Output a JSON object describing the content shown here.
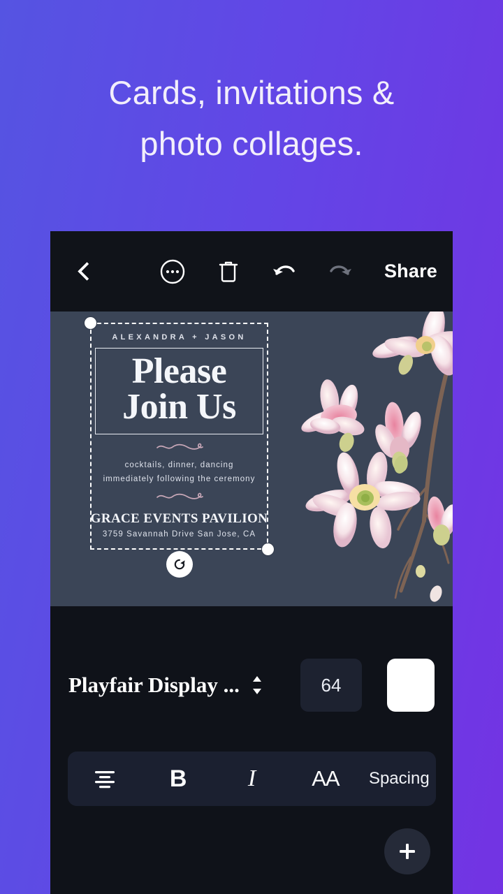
{
  "promo": {
    "headline_line1": "Cards, invitations &",
    "headline_line2": "photo collages."
  },
  "appbar": {
    "back_icon": "chevron-left-icon",
    "more_icon": "more-options-circle-icon",
    "delete_icon": "trash-icon",
    "undo_icon": "undo-arrow-icon",
    "redo_icon": "redo-arrow-icon",
    "share_label": "Share"
  },
  "canvas": {
    "background_color": "#3b4557",
    "artwork": "magnolia-flowers-watercolor",
    "rotate_icon": "rotate-handle-icon",
    "invitation": {
      "names": "ALEXANDRA + JASON",
      "title_line1": "Please",
      "title_line2": "Join Us",
      "detail_line1": "cocktails, dinner, dancing",
      "detail_line2": "immediately following the ceremony",
      "venue": "GRACE EVENTS PAVILION",
      "address": "3759 Savannah Drive San Jose, CA"
    }
  },
  "controls": {
    "font_name": "Playfair Display ...",
    "stepper_icon": "chevron-updown-icon",
    "font_size": "64",
    "color_swatch": "#ffffff"
  },
  "format_bar": {
    "align_icon": "align-center-icon",
    "bold_label": "B",
    "italic_label": "I",
    "case_label": "AA",
    "spacing_label": "Spacing"
  },
  "fab": {
    "add_icon": "plus-icon"
  }
}
